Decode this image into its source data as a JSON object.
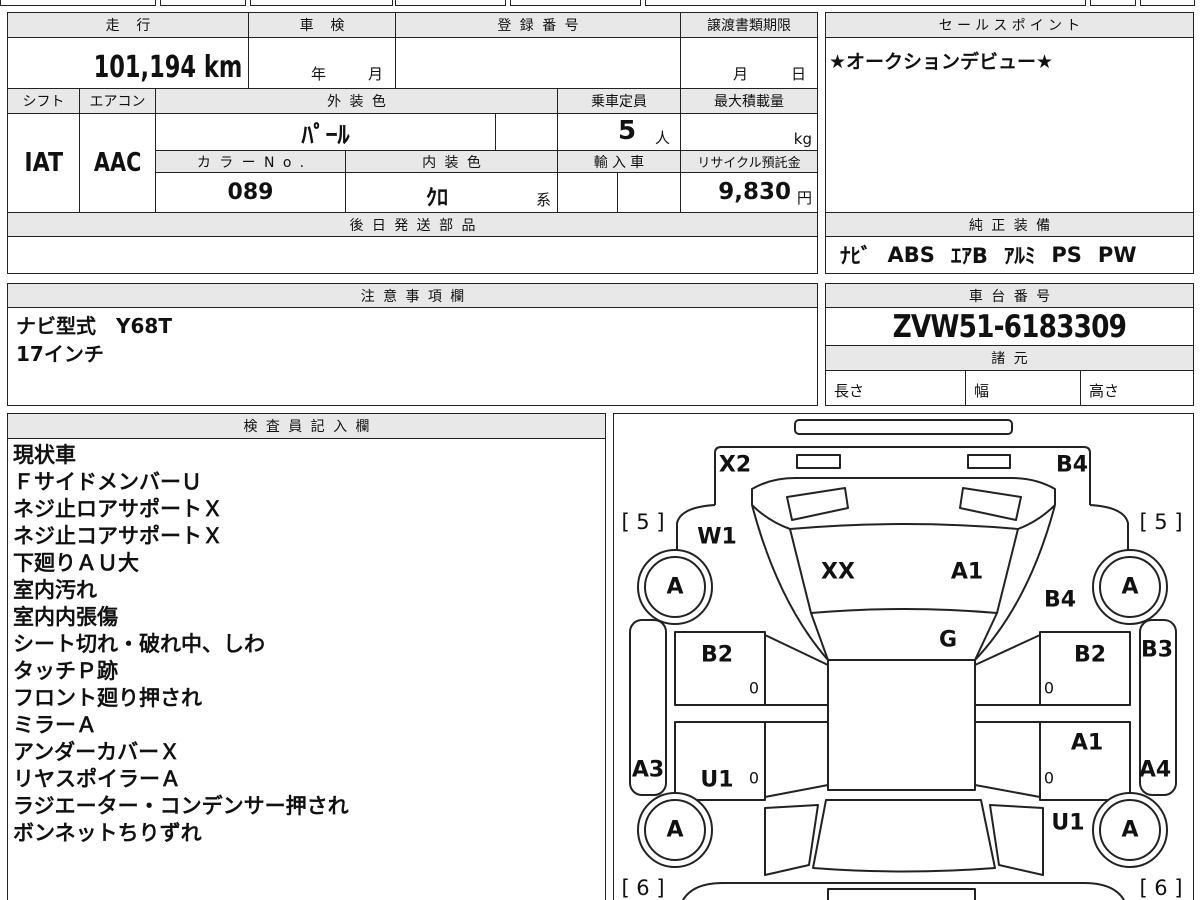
{
  "basic": {
    "labels": {
      "mileage": "走行",
      "inspection": "車検",
      "registration": "登録番号",
      "transfer_deadline": "譲渡書類期限",
      "shift": "シフト",
      "aircon": "エアコン",
      "exterior_color": "外装色",
      "capacity": "乗車定員",
      "max_load": "最大積載量",
      "color_no": "カラーNo.",
      "interior_color": "内装色",
      "import": "輸入車",
      "recycle": "リサイクル預託金",
      "parts_later": "後日発送部品"
    },
    "mileage": "101,194 km",
    "inspection_year_unit": "年",
    "inspection_month_unit": "月",
    "transfer_month_unit": "月",
    "transfer_day_unit": "日",
    "shift": "IAT",
    "aircon": "AAC",
    "exterior_color": "ﾊﾟｰﾙ",
    "capacity": "5",
    "capacity_unit": "人",
    "max_load_unit": "kg",
    "color_no": "089",
    "interior_color": "ｸﾛ",
    "interior_color_suffix": "系",
    "recycle_fee": "9,830",
    "recycle_unit": "円"
  },
  "sales_point": {
    "label": "セールスポイント",
    "text": "★オークションデビュー★"
  },
  "equipment": {
    "label": "純正装備",
    "items": [
      "ﾅﾋﾞ",
      "ABS",
      "ｴｱB",
      "ｱﾙﾐ",
      "PS",
      "PW"
    ]
  },
  "notes": {
    "label": "注意事項欄",
    "lines": [
      "ナビ型式　Y68T",
      "17インチ"
    ]
  },
  "chassis": {
    "label": "車台番号",
    "value": "ZVW51-6183309",
    "spec_label": "諸元",
    "length_label": "長さ",
    "width_label": "幅",
    "height_label": "高さ"
  },
  "inspector": {
    "label": "検査員記入欄",
    "lines": [
      "現状車",
      "ＦサイドメンバーＵ",
      "ネジ止ロアサポートＸ",
      "ネジ止コアサポートＸ",
      "下廻りＡＵ大",
      "室内汚れ",
      "室内内張傷",
      "シート切れ・破れ中、しわ",
      "タッチＰ跡",
      "フロント廻り押され",
      "ミラーＡ",
      "アンダーカバーＸ",
      "リヤスポイラーＡ",
      "ラジエーター・コンデンサー押され",
      "ボンネットちりずれ"
    ]
  },
  "diagram": {
    "marks": [
      "X2",
      "B4",
      "W1",
      "XX",
      "A1",
      "B4",
      "G",
      "B2",
      "B2",
      "B3",
      "A1",
      "A3",
      "U1",
      "A4",
      "U1"
    ],
    "tires": [
      "A",
      "A",
      "A",
      "A"
    ],
    "tread": [
      "[ 5 ]",
      "[ 5 ]",
      "[ 6 ]",
      "[ 6 ]"
    ],
    "zeros": [
      "0",
      "0",
      "0",
      "0"
    ]
  },
  "colors": {
    "border": "#222222",
    "header_bg": "#e8e8e8"
  }
}
